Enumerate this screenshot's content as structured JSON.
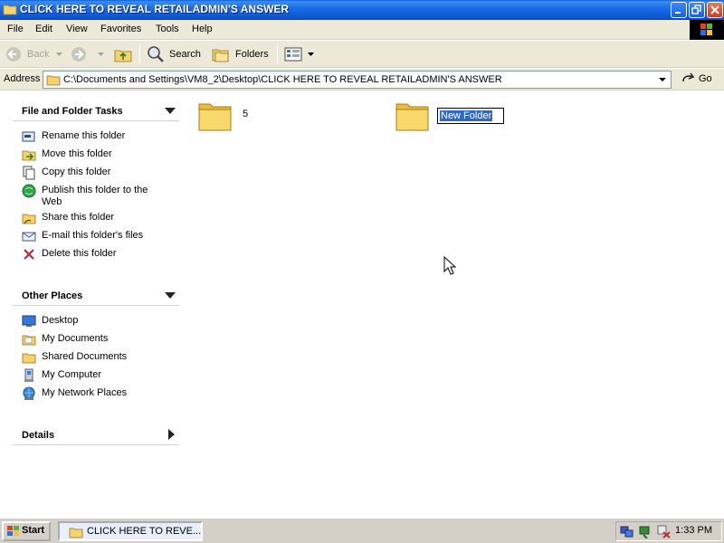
{
  "window": {
    "title": "CLICK HERE TO REVEAL RETAILADMIN'S ANSWER",
    "minimize_icon": "minimize-icon",
    "maximize_icon": "restore-icon",
    "close_icon": "close-icon"
  },
  "menu": {
    "items": [
      "File",
      "Edit",
      "View",
      "Favorites",
      "Tools",
      "Help"
    ]
  },
  "toolbar": {
    "back_label": "Back",
    "search_label": "Search",
    "folders_label": "Folders"
  },
  "address": {
    "label": "Address",
    "value": "C:\\Documents and Settings\\VM8_2\\Desktop\\CLICK HERE TO REVEAL RETAILADMIN'S ANSWER",
    "go_label": "Go"
  },
  "task_pane": {
    "file_folder_tasks": {
      "title": "File and Folder Tasks",
      "items": [
        {
          "label": "Rename this folder",
          "icon": "rename-icon"
        },
        {
          "label": "Move this folder",
          "icon": "move-icon"
        },
        {
          "label": "Copy this folder",
          "icon": "copy-icon"
        },
        {
          "label": "Publish this folder to the Web",
          "icon": "publish-web-icon"
        },
        {
          "label": "Share this folder",
          "icon": "share-icon"
        },
        {
          "label": "E-mail this folder's files",
          "icon": "email-icon"
        },
        {
          "label": "Delete this folder",
          "icon": "delete-icon"
        }
      ]
    },
    "other_places": {
      "title": "Other Places",
      "items": [
        {
          "label": "Desktop",
          "icon": "desktop-icon"
        },
        {
          "label": "My Documents",
          "icon": "my-documents-icon"
        },
        {
          "label": "Shared Documents",
          "icon": "shared-documents-icon"
        },
        {
          "label": "My Computer",
          "icon": "my-computer-icon"
        },
        {
          "label": "My Network Places",
          "icon": "network-places-icon"
        }
      ]
    },
    "details": {
      "title": "Details"
    }
  },
  "content": {
    "folders": [
      {
        "name": "5"
      },
      {
        "name": "New Folder",
        "renaming": true
      }
    ]
  },
  "taskbar": {
    "start_label": "Start",
    "task_label": "CLICK HERE TO REVE...",
    "clock": "1:33 PM"
  },
  "colors": {
    "titlebar": "#0a55d0",
    "selection": "#316ac5",
    "folder_yellow": "#f5d26a"
  }
}
